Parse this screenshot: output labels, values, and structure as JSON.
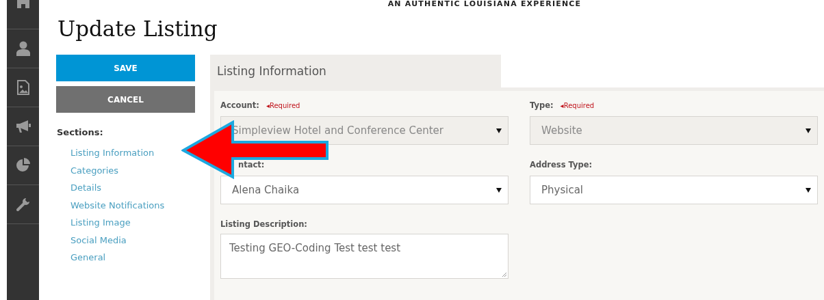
{
  "header": {
    "tagline": "AN AUTHENTIC LOUISIANA EXPERIENCE"
  },
  "page_title": "Update Listing",
  "actions": [
    {
      "label": "SAVE",
      "kind": "primary"
    },
    {
      "label": "CANCEL",
      "kind": "secondary"
    }
  ],
  "sections": {
    "heading": "Sections:",
    "items": [
      "Listing Information",
      "Categories",
      "Details",
      "Website Notifications",
      "Listing Image",
      "Social Media",
      "General"
    ]
  },
  "panel": {
    "tab": "Listing Information",
    "fields": [
      {
        "kind": "select",
        "label": "Account:",
        "required": "◂Required",
        "value": "Simpleview Hotel and Conference Center",
        "disabled": true
      },
      {
        "kind": "select",
        "label": "Type:",
        "required": "◂Required",
        "value": "Website",
        "disabled": true
      },
      {
        "kind": "select",
        "label": "ntact:",
        "value": "Alena Chaika",
        "disabled": false
      },
      {
        "kind": "select",
        "label": "Address Type:",
        "value": "Physical",
        "disabled": false
      },
      {
        "kind": "textarea",
        "label": "Listing Description:",
        "value": "Testing GEO-Coding Test test test",
        "disabled": false
      }
    ]
  }
}
